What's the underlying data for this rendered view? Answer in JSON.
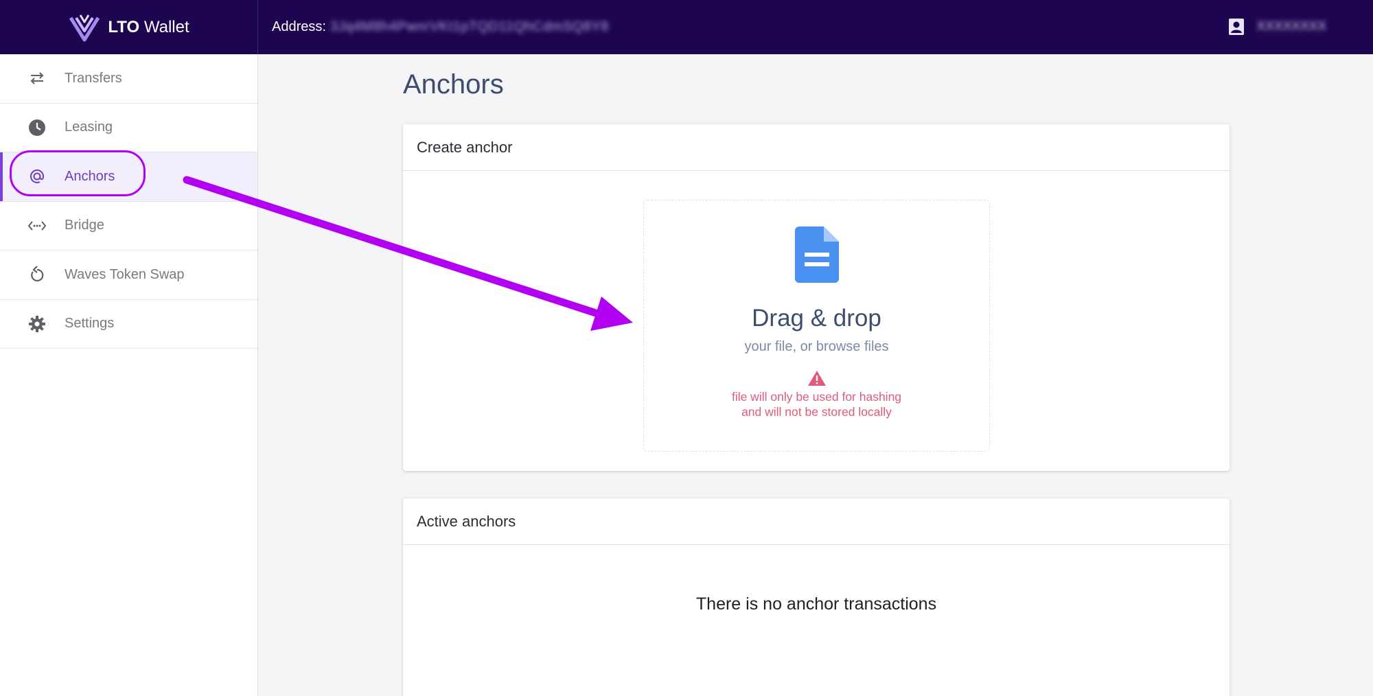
{
  "app": {
    "name_bold": "LTO",
    "name_rest": "Wallet"
  },
  "header": {
    "address_label": "Address:",
    "address_value": "3Jq4M8h4PwnrVKt1pTQD11QhCdmSQ8Y8",
    "account_name": "XXXXXXXX"
  },
  "sidebar": {
    "items": [
      {
        "label": "Transfers",
        "icon": "transfer-arrows-icon"
      },
      {
        "label": "Leasing",
        "icon": "clock-icon"
      },
      {
        "label": "Anchors",
        "icon": "at-sign-icon",
        "active": true
      },
      {
        "label": "Bridge",
        "icon": "bridge-code-icon"
      },
      {
        "label": "Waves Token Swap",
        "icon": "refresh-icon"
      },
      {
        "label": "Settings",
        "icon": "gear-icon"
      }
    ]
  },
  "main": {
    "title": "Anchors",
    "create_card": {
      "title": "Create anchor",
      "dropzone_title": "Drag & drop",
      "dropzone_subtitle": "your file, or browse files",
      "warning_line1": "file will only be used for hashing",
      "warning_line2": "and will not be stored locally"
    },
    "active_card": {
      "title": "Active anchors",
      "empty_message": "There is no anchor transactions"
    }
  },
  "colors": {
    "topbar": "#1e0550",
    "accent": "#7b3fe0",
    "annotation": "#b100f2",
    "warning": "#e05a7a",
    "doc_icon": "#4a90f0"
  }
}
